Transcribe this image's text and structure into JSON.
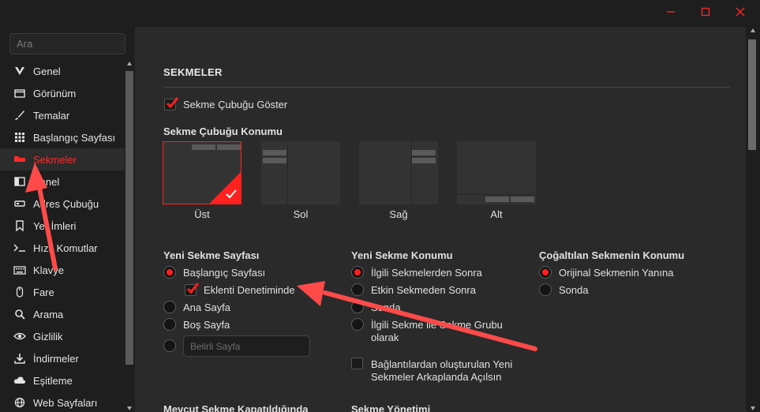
{
  "window": {
    "minimize_symbol": "—",
    "maximize_symbol": "□",
    "close_symbol": "✕",
    "control_color": "#ff2a2a"
  },
  "search": {
    "placeholder": "Ara"
  },
  "sidebar": {
    "items": [
      {
        "label": "Genel",
        "icon": "v-logo-icon"
      },
      {
        "label": "Görünüm",
        "icon": "folder-icon"
      },
      {
        "label": "Temalar",
        "icon": "brush-icon"
      },
      {
        "label": "Başlangıç Sayfası",
        "icon": "grid-icon"
      },
      {
        "label": "Sekmeler",
        "icon": "tabs-icon",
        "active": true
      },
      {
        "label": "Panel",
        "icon": "panel-icon"
      },
      {
        "label": "Adres Çubuğu",
        "icon": "address-bar-icon"
      },
      {
        "label": "Yer İmleri",
        "icon": "bookmark-icon"
      },
      {
        "label": "Hızlı Komutlar",
        "icon": "quick-commands-icon"
      },
      {
        "label": "Klavye",
        "icon": "keyboard-icon"
      },
      {
        "label": "Fare",
        "icon": "mouse-icon"
      },
      {
        "label": "Arama",
        "icon": "search-icon"
      },
      {
        "label": "Gizlilik",
        "icon": "eye-icon"
      },
      {
        "label": "İndirmeler",
        "icon": "download-icon"
      },
      {
        "label": "Eşitleme",
        "icon": "cloud-icon"
      },
      {
        "label": "Web Sayfaları",
        "icon": "globe-icon"
      }
    ]
  },
  "main": {
    "section_title": "SEKMELER",
    "show_tab_bar": {
      "label": "Sekme Çubuğu Göster",
      "checked": true
    },
    "tab_bar_position": {
      "heading": "Sekme Çubuğu Konumu",
      "options": [
        {
          "label": "Üst",
          "selected": true
        },
        {
          "label": "Sol",
          "selected": false
        },
        {
          "label": "Sağ",
          "selected": false
        },
        {
          "label": "Alt",
          "selected": false
        }
      ]
    },
    "new_tab_page": {
      "heading": "Yeni Sekme Sayfası",
      "start_page": "Başlangıç Sayfası",
      "extension_control": "Eklenti Denetiminde",
      "blank_page": "Ana Sayfa",
      "empty_page": "Boş Sayfa",
      "custom_placeholder": "Belirli Sayfa"
    },
    "new_tab_position": {
      "heading": "Yeni Sekme Konumu",
      "after_related": "İlgili Sekmelerden Sonra",
      "after_active": "Etkin Sekmeden Sonra",
      "last": "Sonda",
      "as_group": "İlgili Sekme ile Sekme Grubu olarak",
      "background_links": "Bağlantılardan oluşturulan Yeni Sekmeler Arkaplanda Açılsın"
    },
    "duplicate_position": {
      "heading": "Çoğaltılan Sekmenin Konumu",
      "next_to_original": "Orijinal Sekmenin Yanına",
      "last": "Sonda"
    },
    "closing_heading": "Mevcut Sekme Kapatıldığında",
    "management_heading": "Sekme Yönetimi"
  },
  "colors": {
    "accent": "#ff1f1f",
    "background": "#2a2a2a",
    "sidebar": "#1e1e1e",
    "arrow": "#ff4a4a"
  }
}
